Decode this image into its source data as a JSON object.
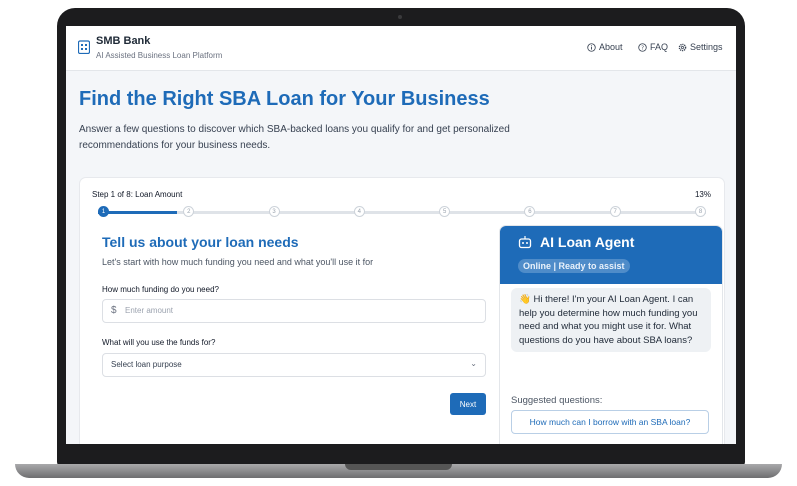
{
  "header": {
    "brand": "SMB Bank",
    "tagline": "AI Assisted Business Loan Platform",
    "nav": [
      {
        "label": "About",
        "icon": "info-icon"
      },
      {
        "label": "FAQ",
        "icon": "help-icon"
      },
      {
        "label": "Settings",
        "icon": "gear-icon"
      }
    ]
  },
  "hero": {
    "title": "Find the Right SBA Loan for Your Business",
    "intro": "Answer a few questions to discover which SBA-backed loans you qualify for and get personalized recommendations for your business needs."
  },
  "progress": {
    "label": "Step 1 of 8: Loan Amount",
    "percent_text": "13%",
    "fraction": 0.13,
    "steps": [
      "1",
      "2",
      "3",
      "4",
      "5",
      "6",
      "7",
      "8"
    ],
    "current_step": 1
  },
  "form": {
    "title": "Tell us about your loan needs",
    "subtitle": "Let's start with how much funding you need and what you'll use it for",
    "amount_label": "How much funding do you need?",
    "amount_prefix": "$",
    "amount_placeholder": "Enter amount",
    "purpose_label": "What will you use the funds for?",
    "purpose_selected": "Select loan purpose",
    "next_label": "Next"
  },
  "agent": {
    "title": "AI Loan Agent",
    "status": "Online | Ready to assist",
    "message": "👋 Hi there! I'm your AI Loan Agent. I can help you determine how much funding you need and what you might use it for. What questions do you have about SBA loans?",
    "suggested_label": "Suggested questions:",
    "suggestions": [
      "How much can I borrow with an SBA loan?"
    ]
  },
  "colors": {
    "accent": "#1e6bb8",
    "page_bg": "#f4f6f9"
  }
}
